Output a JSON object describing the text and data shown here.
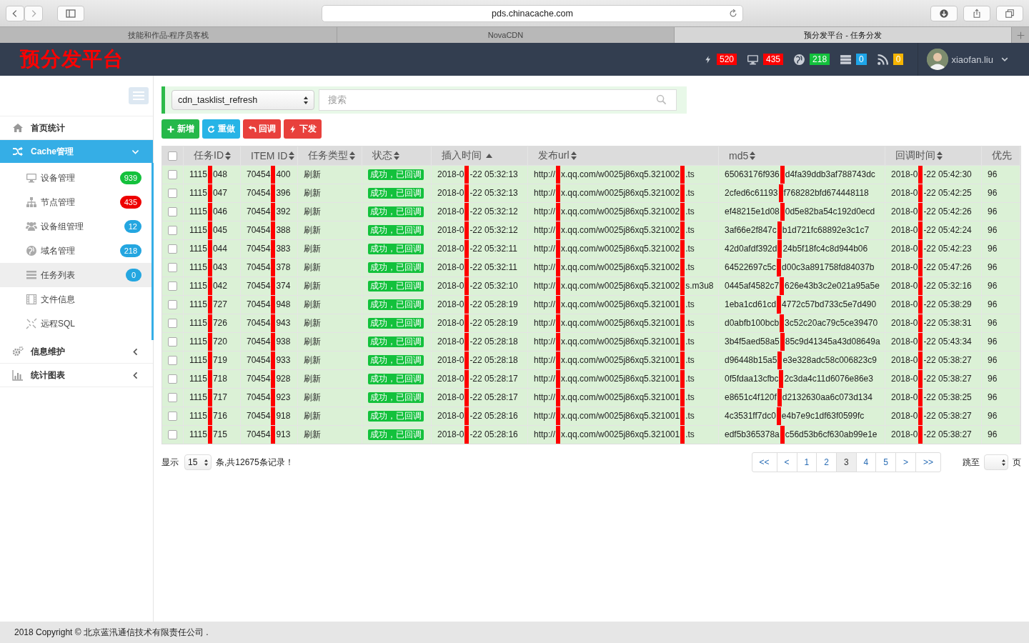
{
  "browser": {
    "address": "pds.chinacache.com",
    "tabs": [
      {
        "label": "技能和作品-程序员客栈",
        "selected": false
      },
      {
        "label": "NovaCDN",
        "selected": false
      },
      {
        "label": "预分发平台 - 任务分发",
        "selected": true
      }
    ]
  },
  "header": {
    "logo": "预分发平台",
    "stats": [
      {
        "count": "520",
        "color": "#ff0000"
      },
      {
        "count": "435",
        "color": "#ff0000"
      },
      {
        "count": "218",
        "color": "#13c13c"
      },
      {
        "count": "0",
        "color": "#1ea5e8"
      },
      {
        "count": "0",
        "color": "#f5b400"
      }
    ],
    "user": "xiaofan.liu"
  },
  "sidebar": {
    "items": [
      {
        "kind": "link",
        "label": "首页统计",
        "selected": false
      },
      {
        "kind": "group",
        "label": "Cache管理",
        "selected": true,
        "expanded": true,
        "children": [
          {
            "label": "设备管理",
            "badge": "939",
            "color": "#13c13c",
            "selected": false
          },
          {
            "label": "节点管理",
            "badge": "435",
            "color": "#ee0000",
            "selected": false
          },
          {
            "label": "设备组管理",
            "badge": "12",
            "color": "#24a6e0",
            "selected": false
          },
          {
            "label": "域名管理",
            "badge": "218",
            "color": "#24a6e0",
            "selected": false
          },
          {
            "label": "任务列表",
            "badge": "0",
            "color": "#24a6e0",
            "selected": true
          },
          {
            "label": "文件信息",
            "selected": false
          },
          {
            "label": "远程SQL",
            "selected": false
          }
        ]
      },
      {
        "kind": "group",
        "label": "信息维护",
        "selected": false,
        "expanded": false
      },
      {
        "kind": "group",
        "label": "统计图表",
        "selected": false,
        "expanded": false
      }
    ]
  },
  "toolbar": {
    "table_select": "cdn_tasklist_refresh",
    "search": {
      "placeholder": "搜索"
    },
    "buttons": [
      {
        "label": "新增",
        "color": "#26b84a"
      },
      {
        "label": "重做",
        "color": "#27b4e6"
      },
      {
        "label": "回调",
        "color": "#e8403c"
      },
      {
        "label": "下发",
        "color": "#e8403c"
      }
    ]
  },
  "table": {
    "select_all_checked": false,
    "columns": [
      {
        "label": "任务ID",
        "sorted": false,
        "kind": "text"
      },
      {
        "label": "ITEM ID",
        "sorted": false,
        "kind": "text"
      },
      {
        "label": "任务类型",
        "sorted": false,
        "kind": "text"
      },
      {
        "label": "状态",
        "sorted": false,
        "kind": "badge"
      },
      {
        "label": "插入时间",
        "sorted": true,
        "kind": "text"
      },
      {
        "label": "发布url",
        "sorted": false,
        "kind": "text"
      },
      {
        "label": "md5",
        "sorted": false,
        "kind": "text"
      },
      {
        "label": "回调时间",
        "sorted": false,
        "kind": "text"
      },
      {
        "label": "优先",
        "kind": "text"
      }
    ],
    "rows": [
      {
        "checked": false,
        "cells": [
          [
            "1115",
            "048"
          ],
          [
            "70454",
            "400"
          ],
          [
            "刷新"
          ],
          [
            "成功，已回调"
          ],
          [
            "2018-0",
            "-22 05:32:13"
          ],
          [
            "http://",
            "x.qq.com/w0025j86xq5.321002",
            ".ts"
          ],
          [
            "65063176f936",
            "d4fa39ddb3af788743dc"
          ],
          [
            "2018-0",
            "-22 05:42:30"
          ],
          [
            "96"
          ]
        ]
      },
      {
        "checked": false,
        "cells": [
          [
            "1115",
            "047"
          ],
          [
            "70454",
            "396"
          ],
          [
            "刷新"
          ],
          [
            "成功，已回调"
          ],
          [
            "2018-0",
            "-22 05:32:13"
          ],
          [
            "http://",
            "x.qq.com/w0025j86xq5.321002",
            ".ts"
          ],
          [
            "2cfed6c61193",
            "f768282bfd674448118"
          ],
          [
            "2018-0",
            "-22 05:42:25"
          ],
          [
            "96"
          ]
        ]
      },
      {
        "checked": false,
        "cells": [
          [
            "1115",
            "046"
          ],
          [
            "70454",
            "392"
          ],
          [
            "刷新"
          ],
          [
            "成功，已回调"
          ],
          [
            "2018-0",
            "-22 05:32:12"
          ],
          [
            "http://",
            "x.qq.com/w0025j86xq5.321002",
            ".ts"
          ],
          [
            "ef48215e1d08",
            "0d5e82ba54c192d0ecd"
          ],
          [
            "2018-0",
            "-22 05:42:26"
          ],
          [
            "96"
          ]
        ]
      },
      {
        "checked": false,
        "cells": [
          [
            "1115",
            "045"
          ],
          [
            "70454",
            "388"
          ],
          [
            "刷新"
          ],
          [
            "成功，已回调"
          ],
          [
            "2018-0",
            "-22 05:32:12"
          ],
          [
            "http://",
            "x.qq.com/w0025j86xq5.321002",
            ".ts"
          ],
          [
            "3af66e2f847c",
            "b1d721fc68892e3c1c7"
          ],
          [
            "2018-0",
            "-22 05:42:24"
          ],
          [
            "96"
          ]
        ]
      },
      {
        "checked": false,
        "cells": [
          [
            "1115",
            "044"
          ],
          [
            "70454",
            "383"
          ],
          [
            "刷新"
          ],
          [
            "成功，已回调"
          ],
          [
            "2018-0",
            "-22 05:32:11"
          ],
          [
            "http://",
            "x.qq.com/w0025j86xq5.321002",
            ".ts"
          ],
          [
            "42d0afdf392d",
            "24b5f18fc4c8d944b06"
          ],
          [
            "2018-0",
            "-22 05:42:23"
          ],
          [
            "96"
          ]
        ]
      },
      {
        "checked": false,
        "cells": [
          [
            "1115",
            "043"
          ],
          [
            "70454",
            "378"
          ],
          [
            "刷新"
          ],
          [
            "成功，已回调"
          ],
          [
            "2018-0",
            "-22 05:32:11"
          ],
          [
            "http://",
            "x.qq.com/w0025j86xq5.321002",
            ".ts"
          ],
          [
            "64522697c5c",
            "d00c3a891758fd84037b"
          ],
          [
            "2018-0",
            "-22 05:47:26"
          ],
          [
            "96"
          ]
        ]
      },
      {
        "checked": false,
        "cells": [
          [
            "1115",
            "042"
          ],
          [
            "70454",
            "374"
          ],
          [
            "刷新"
          ],
          [
            "成功，已回调"
          ],
          [
            "2018-0",
            "-22 05:32:10"
          ],
          [
            "http://",
            "x.qq.com/w0025j86xq5.321002",
            "s.m3u8"
          ],
          [
            "0445af4582c7",
            "626e43b3c2e021a95a5e"
          ],
          [
            "2018-0",
            "-22 05:32:16"
          ],
          [
            "96"
          ]
        ]
      },
      {
        "checked": false,
        "cells": [
          [
            "1115",
            "727"
          ],
          [
            "70454",
            "948"
          ],
          [
            "刷新"
          ],
          [
            "成功，已回调"
          ],
          [
            "2018-0",
            "-22 05:28:19"
          ],
          [
            "http://",
            "x.qq.com/w0025j86xq5.321001",
            ".ts"
          ],
          [
            "1eba1cd61cd",
            "4772c57bd733c5e7d490"
          ],
          [
            "2018-0",
            "-22 05:38:29"
          ],
          [
            "96"
          ]
        ]
      },
      {
        "checked": false,
        "cells": [
          [
            "1115",
            "726"
          ],
          [
            "70454",
            "943"
          ],
          [
            "刷新"
          ],
          [
            "成功，已回调"
          ],
          [
            "2018-0",
            "-22 05:28:19"
          ],
          [
            "http://",
            "x.qq.com/w0025j86xq5.321001",
            ".ts"
          ],
          [
            "d0abfb100bcb",
            "3c52c20ac79c5ce39470"
          ],
          [
            "2018-0",
            "-22 05:38:31"
          ],
          [
            "96"
          ]
        ]
      },
      {
        "checked": false,
        "cells": [
          [
            "1115",
            "720"
          ],
          [
            "70454",
            "938"
          ],
          [
            "刷新"
          ],
          [
            "成功，已回调"
          ],
          [
            "2018-0",
            "-22 05:28:18"
          ],
          [
            "http://",
            "x.qq.com/w0025j86xq5.321001",
            ".ts"
          ],
          [
            "3b4f5aed58a5",
            "85c9d41345a43d08649a"
          ],
          [
            "2018-0",
            "-22 05:43:34"
          ],
          [
            "96"
          ]
        ]
      },
      {
        "checked": false,
        "cells": [
          [
            "1115",
            "719"
          ],
          [
            "70454",
            "933"
          ],
          [
            "刷新"
          ],
          [
            "成功，已回调"
          ],
          [
            "2018-0",
            "-22 05:28:18"
          ],
          [
            "http://",
            "x.qq.com/w0025j86xq5.321001",
            ".ts"
          ],
          [
            "d96448b15a5",
            "e3e328adc58c006823c9"
          ],
          [
            "2018-0",
            "-22 05:38:27"
          ],
          [
            "96"
          ]
        ]
      },
      {
        "checked": false,
        "cells": [
          [
            "1115",
            "718"
          ],
          [
            "70454",
            "928"
          ],
          [
            "刷新"
          ],
          [
            "成功，已回调"
          ],
          [
            "2018-0",
            "-22 05:28:17"
          ],
          [
            "http://",
            "x.qq.com/w0025j86xq5.321001",
            ".ts"
          ],
          [
            "0f5fdaa13cfbc",
            "2c3da4c11d6076e86e3"
          ],
          [
            "2018-0",
            "-22 05:38:27"
          ],
          [
            "96"
          ]
        ]
      },
      {
        "checked": false,
        "cells": [
          [
            "1115",
            "717"
          ],
          [
            "70454",
            "923"
          ],
          [
            "刷新"
          ],
          [
            "成功，已回调"
          ],
          [
            "2018-0",
            "-22 05:28:17"
          ],
          [
            "http://",
            "x.qq.com/w0025j86xq5.321001",
            ".ts"
          ],
          [
            "e8651c4f120f",
            "d2132630aa6c073d134"
          ],
          [
            "2018-0",
            "-22 05:38:25"
          ],
          [
            "96"
          ]
        ]
      },
      {
        "checked": false,
        "cells": [
          [
            "1115",
            "716"
          ],
          [
            "70454",
            "918"
          ],
          [
            "刷新"
          ],
          [
            "成功，已回调"
          ],
          [
            "2018-0",
            "-22 05:28:16"
          ],
          [
            "http://",
            "x.qq.com/w0025j86xq5.321001",
            ".ts"
          ],
          [
            "4c3531ff7dc0",
            "e4b7e9c1df63f0599fc"
          ],
          [
            "2018-0",
            "-22 05:38:27"
          ],
          [
            "96"
          ]
        ]
      },
      {
        "checked": false,
        "cells": [
          [
            "1115",
            "715"
          ],
          [
            "70454",
            "913"
          ],
          [
            "刷新"
          ],
          [
            "成功，已回调"
          ],
          [
            "2018-0",
            "-22 05:28:16"
          ],
          [
            "http://",
            "x.qq.com/w0025j86xq5.321001",
            ".ts"
          ],
          [
            "edf5b365378a",
            "c56d53b6cf630ab99e1e"
          ],
          [
            "2018-0",
            "-22 05:38:27"
          ],
          [
            "96"
          ]
        ]
      }
    ]
  },
  "pager": {
    "show_label": "显示",
    "page_size": "15",
    "total_text": "条,共12675条记录！",
    "pages": [
      {
        "label": "<<",
        "selected": false
      },
      {
        "label": "<",
        "selected": false
      },
      {
        "label": "1",
        "selected": false
      },
      {
        "label": "2",
        "selected": false
      },
      {
        "label": "3",
        "selected": true
      },
      {
        "label": "4",
        "selected": false
      },
      {
        "label": "5",
        "selected": false
      },
      {
        "label": ">",
        "selected": false
      },
      {
        "label": ">>",
        "selected": false
      }
    ],
    "jump_label": "跳至",
    "page_unit": "页"
  },
  "footer": {
    "text": "2018 Copyright © 北京蓝汛通信技术有限责任公司 ."
  }
}
